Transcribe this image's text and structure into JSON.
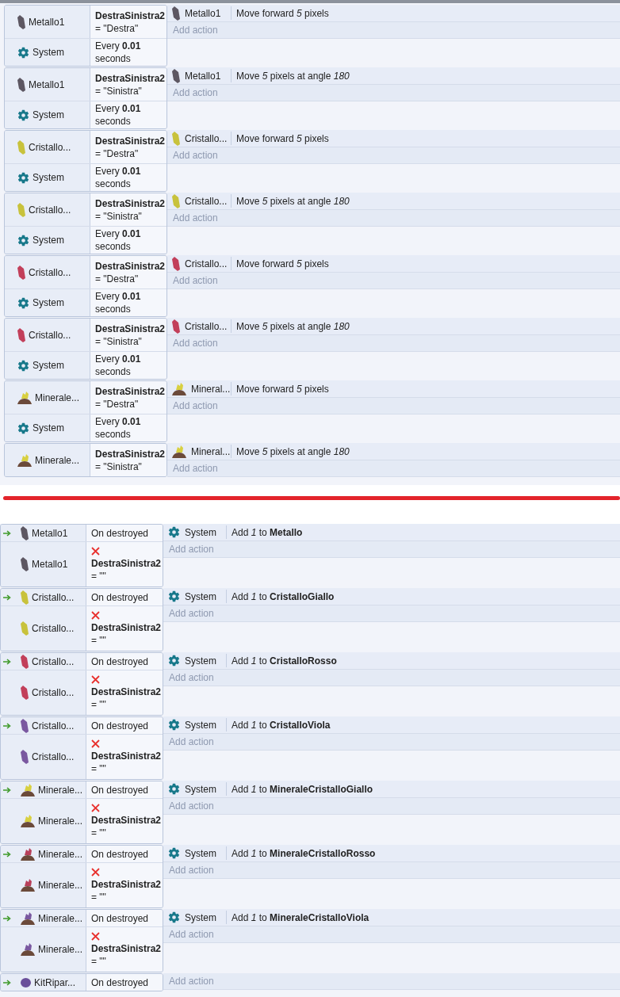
{
  "top_events": [
    {
      "conditions": [
        {
          "object": {
            "name": "Metallo1",
            "kind": "crystal",
            "color": "#5d5762"
          },
          "text": "**DestraSinistra2**\n= \"Destra\""
        },
        {
          "object": {
            "name": "System",
            "kind": "gear"
          },
          "text": "Every **0.01**\nseconds"
        }
      ],
      "actions": [
        {
          "object": {
            "name": "Metallo1",
            "kind": "crystal",
            "color": "#5d5762"
          },
          "text": "Move forward *5* pixels"
        }
      ],
      "add_action": "Add action"
    },
    {
      "conditions": [
        {
          "object": {
            "name": "Metallo1",
            "kind": "crystal",
            "color": "#5d5762"
          },
          "text": "**DestraSinistra2**\n= \"Sinistra\""
        },
        {
          "object": {
            "name": "System",
            "kind": "gear"
          },
          "text": "Every **0.01**\nseconds"
        }
      ],
      "actions": [
        {
          "object": {
            "name": "Metallo1",
            "kind": "crystal",
            "color": "#5d5762"
          },
          "text": "Move *5* pixels at angle *180*"
        }
      ],
      "add_action": "Add action"
    },
    {
      "conditions": [
        {
          "object": {
            "name": "Cristallo...",
            "kind": "crystal",
            "color": "#c8c23c"
          },
          "text": "**DestraSinistra2**\n= \"Destra\""
        },
        {
          "object": {
            "name": "System",
            "kind": "gear"
          },
          "text": "Every **0.01**\nseconds"
        }
      ],
      "actions": [
        {
          "object": {
            "name": "Cristallo...",
            "kind": "crystal",
            "color": "#c8c23c"
          },
          "text": "Move forward *5* pixels"
        }
      ],
      "add_action": "Add action"
    },
    {
      "conditions": [
        {
          "object": {
            "name": "Cristallo...",
            "kind": "crystal",
            "color": "#c8c23c"
          },
          "text": "**DestraSinistra2**\n= \"Sinistra\""
        },
        {
          "object": {
            "name": "System",
            "kind": "gear"
          },
          "text": "Every **0.01**\nseconds"
        }
      ],
      "actions": [
        {
          "object": {
            "name": "Cristallo...",
            "kind": "crystal",
            "color": "#c8c23c"
          },
          "text": "Move *5* pixels at angle *180*"
        }
      ],
      "add_action": "Add action"
    },
    {
      "conditions": [
        {
          "object": {
            "name": "Cristallo...",
            "kind": "crystal",
            "color": "#c23f5a"
          },
          "text": "**DestraSinistra2**\n= \"Destra\""
        },
        {
          "object": {
            "name": "System",
            "kind": "gear"
          },
          "text": "Every **0.01**\nseconds"
        }
      ],
      "actions": [
        {
          "object": {
            "name": "Cristallo...",
            "kind": "crystal",
            "color": "#c23f5a"
          },
          "text": "Move forward *5* pixels"
        }
      ],
      "add_action": "Add action"
    },
    {
      "conditions": [
        {
          "object": {
            "name": "Cristallo...",
            "kind": "crystal",
            "color": "#c23f5a"
          },
          "text": "**DestraSinistra2**\n= \"Sinistra\""
        },
        {
          "object": {
            "name": "System",
            "kind": "gear"
          },
          "text": "Every **0.01**\nseconds"
        }
      ],
      "actions": [
        {
          "object": {
            "name": "Cristallo...",
            "kind": "crystal",
            "color": "#c23f5a"
          },
          "text": "Move *5* pixels at angle *180*"
        }
      ],
      "add_action": "Add action"
    },
    {
      "conditions": [
        {
          "object": {
            "name": "Minerale...",
            "kind": "mineral",
            "color": "#d8d040"
          },
          "text": "**DestraSinistra2**\n= \"Destra\""
        },
        {
          "object": {
            "name": "System",
            "kind": "gear"
          },
          "text": "Every **0.01**\nseconds"
        }
      ],
      "actions": [
        {
          "object": {
            "name": "Mineral...",
            "kind": "mineral",
            "color": "#d8d040"
          },
          "text": "Move forward *5* pixels"
        }
      ],
      "add_action": "Add action"
    },
    {
      "conditions": [
        {
          "object": {
            "name": "Minerale...",
            "kind": "mineral",
            "color": "#d8d040"
          },
          "text": "**DestraSinistra2**\n= \"Sinistra\""
        }
      ],
      "actions": [
        {
          "object": {
            "name": "Mineral...",
            "kind": "mineral",
            "color": "#d8d040"
          },
          "text": "Move *5* pixels at angle *180*"
        }
      ],
      "add_action": "Add action"
    }
  ],
  "bottom_events": [
    {
      "conditions": [
        {
          "trigger": true,
          "object": {
            "name": "Metallo1",
            "kind": "crystal",
            "color": "#5d5762"
          },
          "text": "On destroyed"
        },
        {
          "inverted": true,
          "object": {
            "name": "Metallo1",
            "kind": "crystal",
            "color": "#5d5762"
          },
          "text": "**DestraSinistra2**\n= \"\""
        }
      ],
      "actions": [
        {
          "object": {
            "name": "System",
            "kind": "gear"
          },
          "text": "Add *1* to **Metallo**"
        }
      ],
      "add_action": "Add action"
    },
    {
      "conditions": [
        {
          "trigger": true,
          "object": {
            "name": "Cristallo...",
            "kind": "crystal",
            "color": "#c8c23c"
          },
          "text": "On destroyed"
        },
        {
          "inverted": true,
          "object": {
            "name": "Cristallo...",
            "kind": "crystal",
            "color": "#c8c23c"
          },
          "text": "**DestraSinistra2**\n= \"\""
        }
      ],
      "actions": [
        {
          "object": {
            "name": "System",
            "kind": "gear"
          },
          "text": "Add *1* to **CristalloGiallo**"
        }
      ],
      "add_action": "Add action"
    },
    {
      "conditions": [
        {
          "trigger": true,
          "object": {
            "name": "Cristallo...",
            "kind": "crystal",
            "color": "#c23f5a"
          },
          "text": "On destroyed"
        },
        {
          "inverted": true,
          "object": {
            "name": "Cristallo...",
            "kind": "crystal",
            "color": "#c23f5a"
          },
          "text": "**DestraSinistra2**\n= \"\""
        }
      ],
      "actions": [
        {
          "object": {
            "name": "System",
            "kind": "gear"
          },
          "text": "Add *1* to **CristalloRosso**"
        }
      ],
      "add_action": "Add action"
    },
    {
      "conditions": [
        {
          "trigger": true,
          "object": {
            "name": "Cristallo...",
            "kind": "crystal",
            "color": "#7a58a0"
          },
          "text": "On destroyed"
        },
        {
          "inverted": true,
          "object": {
            "name": "Cristallo...",
            "kind": "crystal",
            "color": "#7a58a0"
          },
          "text": "**DestraSinistra2**\n= \"\""
        }
      ],
      "actions": [
        {
          "object": {
            "name": "System",
            "kind": "gear"
          },
          "text": "Add *1* to **CristalloViola**"
        }
      ],
      "add_action": "Add action"
    },
    {
      "conditions": [
        {
          "trigger": true,
          "object": {
            "name": "Minerale...",
            "kind": "mineral",
            "color": "#d8d040"
          },
          "text": "On destroyed"
        },
        {
          "inverted": true,
          "object": {
            "name": "Minerale...",
            "kind": "mineral",
            "color": "#d8d040"
          },
          "text": "**DestraSinistra2**\n= \"\""
        }
      ],
      "actions": [
        {
          "object": {
            "name": "System",
            "kind": "gear"
          },
          "text": "Add *1* to **MineraleCristalloGiallo**"
        }
      ],
      "add_action": "Add action"
    },
    {
      "conditions": [
        {
          "trigger": true,
          "object": {
            "name": "Minerale...",
            "kind": "mineral",
            "color": "#b8405a"
          },
          "text": "On destroyed"
        },
        {
          "inverted": true,
          "object": {
            "name": "Minerale...",
            "kind": "mineral",
            "color": "#b8405a"
          },
          "text": "**DestraSinistra2**\n= \"\""
        }
      ],
      "actions": [
        {
          "object": {
            "name": "System",
            "kind": "gear"
          },
          "text": "Add *1* to **MineraleCristalloRosso**"
        }
      ],
      "add_action": "Add action"
    },
    {
      "conditions": [
        {
          "trigger": true,
          "object": {
            "name": "Minerale...",
            "kind": "mineral",
            "color": "#7a58a0"
          },
          "text": "On destroyed"
        },
        {
          "inverted": true,
          "object": {
            "name": "Minerale...",
            "kind": "mineral",
            "color": "#7a58a0"
          },
          "text": "**DestraSinistra2**\n= \"\""
        }
      ],
      "actions": [
        {
          "object": {
            "name": "System",
            "kind": "gear"
          },
          "text": "Add *1* to **MineraleCristalloViola**"
        }
      ],
      "add_action": "Add action"
    },
    {
      "conditions": [
        {
          "trigger": true,
          "object": {
            "name": "KitRipar...",
            "kind": "kit",
            "color": "#6a4f9a"
          },
          "text": "On destroyed"
        }
      ],
      "add_action": "Add action"
    }
  ]
}
